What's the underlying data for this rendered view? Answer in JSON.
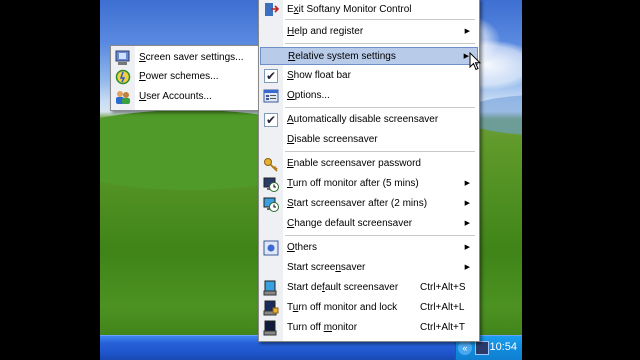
{
  "colors": {
    "highlight": "#b8cbe8",
    "taskbar": "#2660d8",
    "tray": "#138ee0"
  },
  "taskbar": {
    "clock": "10:54",
    "tray_arrow": "«"
  },
  "submenu": {
    "items": [
      {
        "pre": "",
        "u": "S",
        "post": "creen saver settings...",
        "icon": "screen-saver-icon"
      },
      {
        "pre": "",
        "u": "P",
        "post": "ower schemes...",
        "icon": "power-schemes-icon"
      },
      {
        "pre": "",
        "u": "U",
        "post": "ser Accounts...",
        "icon": "user-accounts-icon"
      }
    ]
  },
  "menu": {
    "items": [
      {
        "pre": "E",
        "u": "x",
        "post": "it Softany Monitor Control",
        "shortcut": "",
        "arrow": "",
        "icon": "exit-icon"
      },
      {
        "pre": "",
        "u": "H",
        "post": "elp and register",
        "shortcut": "",
        "arrow": "▶",
        "icon": ""
      },
      {
        "pre": "",
        "u": "R",
        "post": "elative system settings",
        "shortcut": "",
        "arrow": "▶",
        "icon": ""
      },
      {
        "pre": "",
        "u": "S",
        "post": "how float bar",
        "shortcut": "",
        "arrow": "",
        "icon": "check-icon"
      },
      {
        "pre": "",
        "u": "O",
        "post": "ptions...",
        "shortcut": "",
        "arrow": "",
        "icon": "options-icon"
      },
      {
        "pre": "",
        "u": "A",
        "post": "utomatically disable screensaver",
        "shortcut": "",
        "arrow": "",
        "icon": "check-icon"
      },
      {
        "pre": "",
        "u": "D",
        "post": "isable screensaver",
        "shortcut": "",
        "arrow": "",
        "icon": ""
      },
      {
        "pre": "",
        "u": "E",
        "post": "nable screensaver password",
        "shortcut": "",
        "arrow": "",
        "icon": "key-icon"
      },
      {
        "pre": "",
        "u": "T",
        "post": "urn off monitor after (5 mins)",
        "shortcut": "",
        "arrow": "▶",
        "icon": "monitor-timer-icon"
      },
      {
        "pre": "",
        "u": "S",
        "post": "tart screensaver after (2 mins)",
        "shortcut": "",
        "arrow": "▶",
        "icon": "screensaver-timer-icon"
      },
      {
        "pre": "",
        "u": "C",
        "post": "hange default screensaver",
        "shortcut": "",
        "arrow": "▶",
        "icon": ""
      },
      {
        "pre": "",
        "u": "O",
        "post": "thers",
        "shortcut": "",
        "arrow": "▶",
        "icon": "others-icon"
      },
      {
        "pre": "Start scree",
        "u": "n",
        "post": "saver",
        "shortcut": "",
        "arrow": "▶",
        "icon": ""
      },
      {
        "pre": "Start de",
        "u": "f",
        "post": "ault screensaver",
        "shortcut": "Ctrl+Alt+S",
        "arrow": "",
        "icon": "start-default-icon"
      },
      {
        "pre": "T",
        "u": "u",
        "post": "rn off monitor and lock",
        "shortcut": "Ctrl+Alt+L",
        "arrow": "",
        "icon": "lock-monitor-icon"
      },
      {
        "pre": "Turn off ",
        "u": "m",
        "post": "onitor",
        "shortcut": "Ctrl+Alt+T",
        "arrow": "",
        "icon": "turn-off-monitor-icon"
      }
    ]
  }
}
